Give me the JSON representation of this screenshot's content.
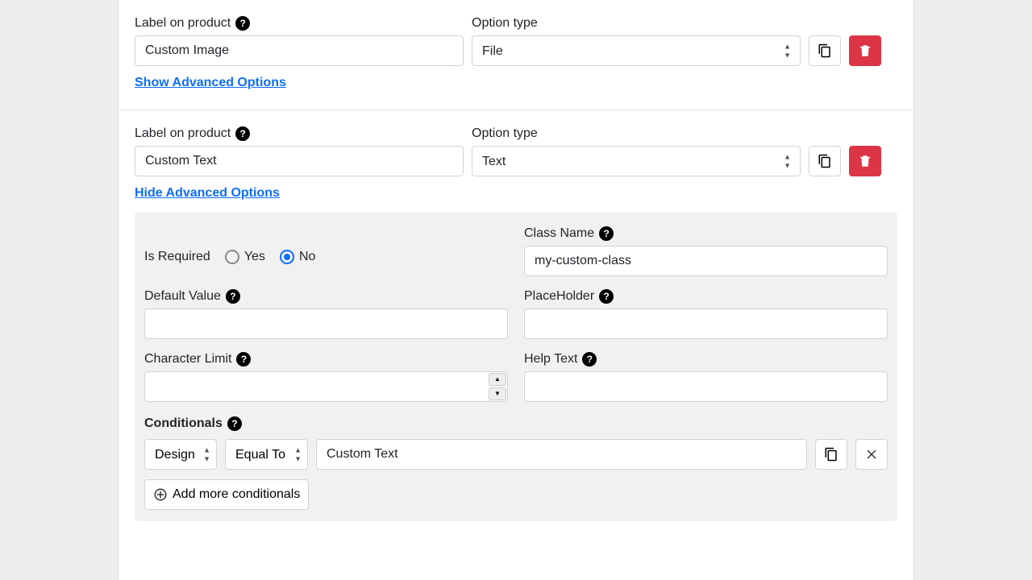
{
  "opt1": {
    "label_label": "Label on product",
    "label_value": "Custom Image",
    "type_label": "Option type",
    "type_value": "File",
    "toggle": "Show Advanced Options"
  },
  "opt2": {
    "label_label": "Label on product",
    "label_value": "Custom Text",
    "type_label": "Option type",
    "type_value": "Text",
    "toggle": "Hide Advanced Options"
  },
  "adv": {
    "is_required_label": "Is Required",
    "yes": "Yes",
    "no": "No",
    "required_selected": "no",
    "class_name_label": "Class Name",
    "class_name_value": "my-custom-class",
    "default_value_label": "Default Value",
    "default_value": "",
    "placeholder_label": "PlaceHolder",
    "placeholder_value": "",
    "char_limit_label": "Character Limit",
    "char_limit_value": "",
    "help_text_label": "Help Text",
    "help_text_value": "",
    "conditionals_label": "Conditionals",
    "cond_field": "Design",
    "cond_op": "Equal To",
    "cond_value": "Custom Text",
    "add_more": "Add more conditionals"
  }
}
